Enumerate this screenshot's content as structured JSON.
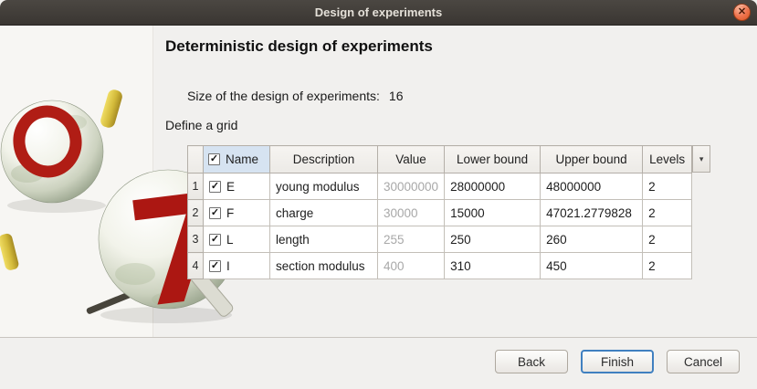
{
  "window": {
    "title": "Design of experiments"
  },
  "icons": {
    "close": "✕",
    "dropdown": "▾",
    "check": "✓"
  },
  "logo": {
    "letter_seven": "7"
  },
  "page": {
    "heading": "Deterministic design of experiments",
    "size_label": "Size of the design of experiments:",
    "size_value": "16",
    "grid_label": "Define a grid"
  },
  "grid": {
    "headers": {
      "name": "Name",
      "description": "Description",
      "value": "Value",
      "lower_bound": "Lower bound",
      "upper_bound": "Upper bound",
      "levels": "Levels"
    },
    "rows": [
      {
        "num": "1",
        "name": "E",
        "description": "young modulus",
        "value": "30000000",
        "lower_bound": "28000000",
        "upper_bound": "48000000",
        "levels": "2"
      },
      {
        "num": "2",
        "name": "F",
        "description": "charge",
        "value": "30000",
        "lower_bound": "15000",
        "upper_bound": "47021.2779828",
        "levels": "2"
      },
      {
        "num": "3",
        "name": "L",
        "description": "length",
        "value": "255",
        "lower_bound": "250",
        "upper_bound": "260",
        "levels": "2"
      },
      {
        "num": "4",
        "name": "I",
        "description": "section modulus",
        "value": "400",
        "lower_bound": "310",
        "upper_bound": "450",
        "levels": "2"
      }
    ]
  },
  "buttons": {
    "back": "Back",
    "finish": "Finish",
    "cancel": "Cancel"
  },
  "colors": {
    "titlebar": "#3d3934",
    "close_button": "#ee6b3e",
    "header_highlight": "#d6e3f1",
    "focus_accent": "#4080c0",
    "disabled_text": "#a8a8a8",
    "logo_red": "#b01d15",
    "pin_yellow": "#d3ba3a"
  }
}
